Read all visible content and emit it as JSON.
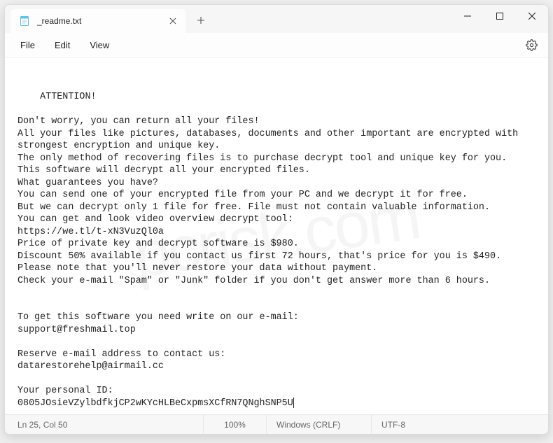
{
  "tab": {
    "title": "_readme.txt"
  },
  "menu": {
    "file": "File",
    "edit": "Edit",
    "view": "View"
  },
  "body": {
    "text": "ATTENTION!\n\nDon't worry, you can return all your files!\nAll your files like pictures, databases, documents and other important are encrypted with strongest encryption and unique key.\nThe only method of recovering files is to purchase decrypt tool and unique key for you.\nThis software will decrypt all your encrypted files.\nWhat guarantees you have?\nYou can send one of your encrypted file from your PC and we decrypt it for free.\nBut we can decrypt only 1 file for free. File must not contain valuable information.\nYou can get and look video overview decrypt tool:\nhttps://we.tl/t-xN3VuzQl0a\nPrice of private key and decrypt software is $980.\nDiscount 50% available if you contact us first 72 hours, that's price for you is $490.\nPlease note that you'll never restore your data without payment.\nCheck your e-mail \"Spam\" or \"Junk\" folder if you don't get answer more than 6 hours.\n\n\nTo get this software you need write on our e-mail:\nsupport@freshmail.top\n\nReserve e-mail address to contact us:\ndatarestorehelp@airmail.cc\n\nYour personal ID:\n0805JOsieVZylbdfkjCP2wKYcHLBeCxpmsXCfRN7QNghSNP5U"
  },
  "status": {
    "position": "Ln 25, Col 50",
    "zoom": "100%",
    "eol": "Windows (CRLF)",
    "encoding": "UTF-8"
  },
  "watermark": "pcrisk.com"
}
